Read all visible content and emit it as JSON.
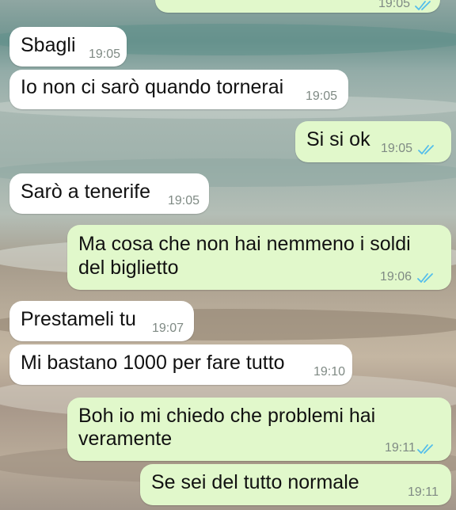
{
  "conversation": {
    "messages": [
      {
        "text": "",
        "time": "19:05",
        "direction": "outgoing",
        "read": true
      },
      {
        "text": "Sbagli",
        "time": "19:05",
        "direction": "incoming"
      },
      {
        "text": "Io non ci sarò quando tornerai",
        "time": "19:05",
        "direction": "incoming"
      },
      {
        "text": "Si si ok",
        "time": "19:05",
        "direction": "outgoing",
        "read": true
      },
      {
        "text": "Sarò a tenerife",
        "time": "19:05",
        "direction": "incoming"
      },
      {
        "text_line1": "Ma cosa che non hai nemmeno i soldi",
        "text_line2": "del biglietto",
        "time": "19:06",
        "direction": "outgoing",
        "read": true
      },
      {
        "text": "Prestameli tu",
        "time": "19:07",
        "direction": "incoming"
      },
      {
        "text": "Mi bastano 1000 per fare tutto",
        "time": "19:10",
        "direction": "incoming"
      },
      {
        "text_line1": "Boh io mi chiedo che problemi hai",
        "text_line2": "veramente",
        "time": "19:11",
        "direction": "outgoing",
        "read": true
      },
      {
        "text": "Se sei del tutto normale",
        "time": "19:11",
        "direction": "outgoing",
        "read": false
      }
    ]
  },
  "colors": {
    "incoming_bubble": "#ffffff",
    "outgoing_bubble": "#e1f8cb",
    "read_ticks": "#53bdeb",
    "timestamp": "#7f8a84"
  },
  "icons": {
    "read_receipt": "double-check-icon"
  }
}
